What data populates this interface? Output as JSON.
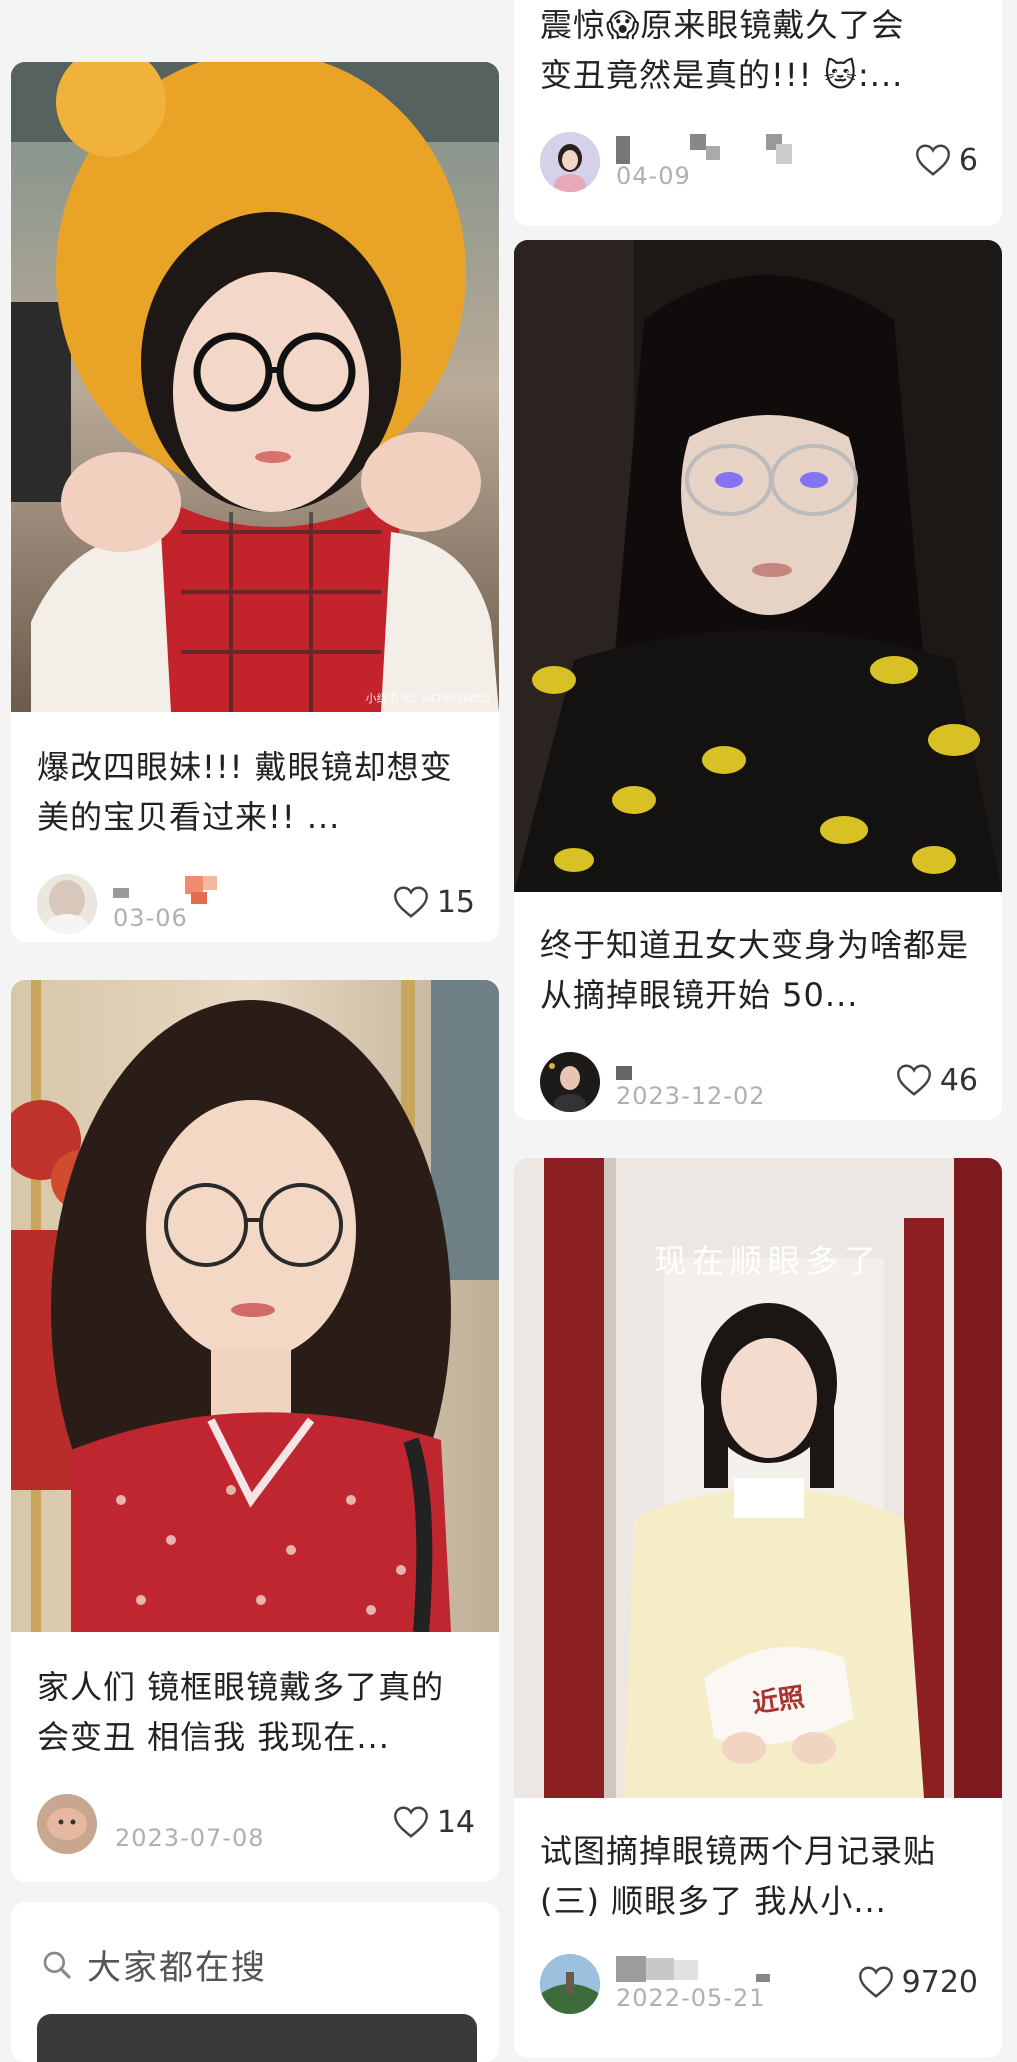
{
  "cards": {
    "top_right": {
      "title_line1": "震惊😱原来眼镜戴久了会",
      "title_line2": "变丑竟然是真的!!! 🐱:...",
      "date": "04-09",
      "likes": "6"
    },
    "left1": {
      "title": "爆改四眼妹!!! 戴眼镜却想变美的宝贝看过来!! ...",
      "date": "03-06",
      "likes": "15",
      "watermark": "小红书 ID: 5416936855"
    },
    "right1": {
      "title": "终于知道丑女大变身为啥都是从摘掉眼镜开始 50...",
      "date": "2023-12-02",
      "likes": "46"
    },
    "left2": {
      "title": "家人们 镜框眼镜戴多了真的会变丑 相信我 我现在...",
      "date": "2023-07-08",
      "likes": "14"
    },
    "right2": {
      "overlay": "现在顺眼多了",
      "sign": "近照",
      "title": "试图摘掉眼镜两个月记录贴 (三) 顺眼多了 我从小...",
      "date": "2022-05-21",
      "likes": "9720"
    }
  },
  "search": {
    "label": "大家都在搜"
  },
  "colors": {
    "background": "#f4f4f4",
    "card": "#ffffff",
    "text": "#222222",
    "muted": "#b0b0b0"
  }
}
